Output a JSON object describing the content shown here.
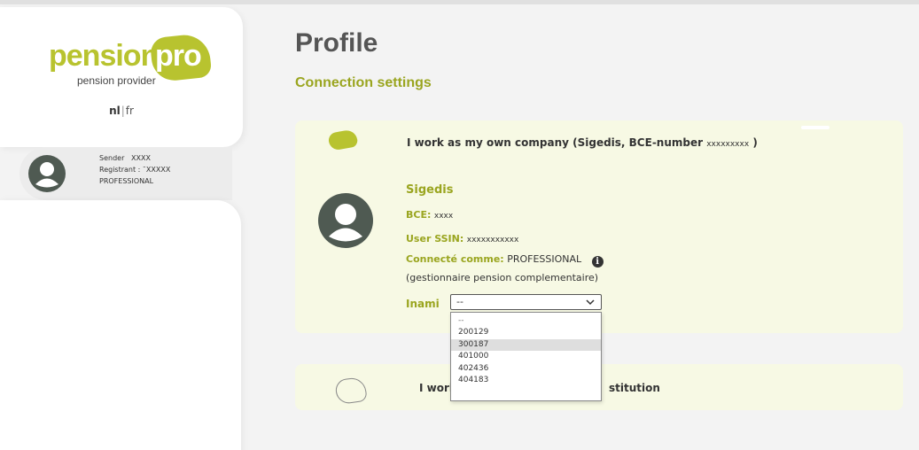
{
  "brand": {
    "word1": "pension",
    "word2": "pro",
    "tagline": "pension provider",
    "color": "#b8c32f"
  },
  "language": {
    "nl": "nl",
    "separator": "|",
    "fr": "fr"
  },
  "user": {
    "sender_label": "Sender",
    "sender_value": "XXXX",
    "registrant_label": "Registrant :",
    "registrant_value": "¯XXXXX",
    "role": "PROFESSIONAL"
  },
  "page": {
    "title": "Profile",
    "section": "Connection settings"
  },
  "own_company": {
    "heading": "I work as my own company (Sigedis, BCE-number",
    "heading_value": "xxxxxxxxx",
    "heading_close": ")",
    "name": "Sigedis",
    "bce_label": "BCE",
    "bce_value": "xxxx",
    "ssin_label": "User SSIN",
    "ssin_value": "xxxxxxxxxxx",
    "connected_label": "Connecté comme",
    "connected_value": "PROFESSIONAL",
    "info_icon": "i",
    "role_desc": "(gestionnaire pension complementaire)",
    "inami_label": "Inami",
    "inami_selected": "--",
    "chevron": "⌄"
  },
  "inami_options": {
    "first": "--",
    "opt1": "200129",
    "opt2": "300187",
    "opt3": "401000",
    "opt4": "402436",
    "opt5": "404183"
  },
  "institution": {
    "heading_left": "I work",
    "heading_right": "stitution"
  },
  "colors": {
    "accent": "#9aa51f",
    "panel_bg": "#f7f9e4",
    "avatar": "#4f5a52"
  }
}
